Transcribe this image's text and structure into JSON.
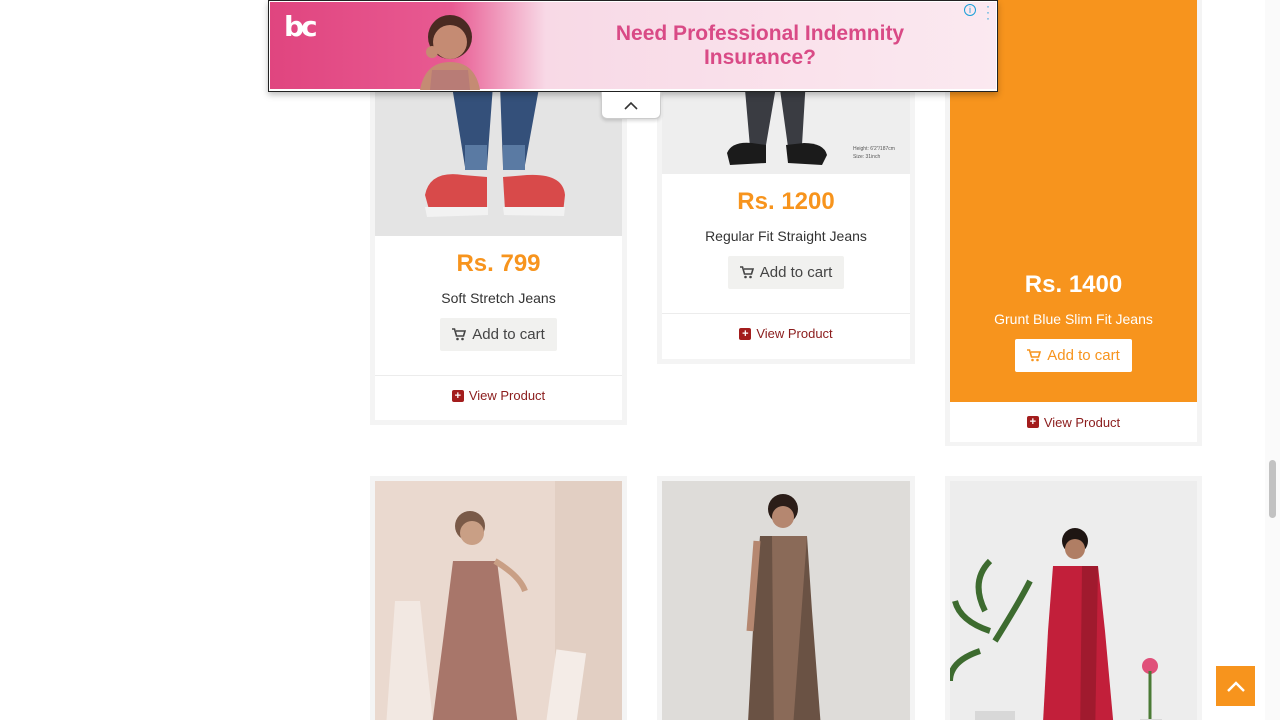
{
  "ad": {
    "logo": "bc",
    "headline": "Need Professional Indemnity Insurance?",
    "info_icon": "info-icon",
    "menu_icon": "kebab-menu-icon",
    "collapse_icon": "chevron-up-icon"
  },
  "products": [
    {
      "price": "Rs. 799",
      "name": "Soft Stretch Jeans",
      "cart_label": "Add to cart",
      "view_label": "View Product"
    },
    {
      "price": "Rs. 1200",
      "name": "Regular Fit Straight Jeans",
      "cart_label": "Add to cart",
      "view_label": "View Product",
      "image_caption": "Height: 6'2\"/187cm\nSize: 31inch"
    },
    {
      "price": "Rs. 1400",
      "name": "Grunt Blue Slim Fit Jeans",
      "cart_label": "Add to cart",
      "view_label": "View Product",
      "featured": true
    }
  ],
  "second_row": [
    {
      "image": "woman-in-mauve-tiered-dress"
    },
    {
      "image": "woman-in-printed-saree"
    },
    {
      "image": "woman-in-red-saree-with-plants"
    }
  ],
  "scroll_to_top_icon": "chevron-up-icon",
  "colors": {
    "accent": "#f7941d",
    "link": "#8b1c1c",
    "ad_pink": "#d94a86"
  }
}
